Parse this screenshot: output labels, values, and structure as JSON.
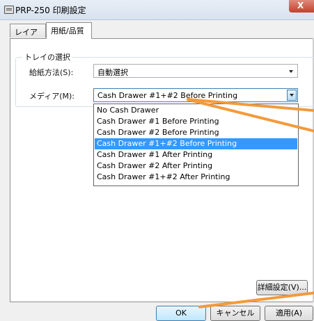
{
  "window": {
    "title": "PRP-250 印刷設定",
    "close_label": "X"
  },
  "tabs": [
    {
      "label": "レイアウト",
      "active": false
    },
    {
      "label": "用紙/品質",
      "active": true
    }
  ],
  "tray_group": {
    "legend": "トレイの選択",
    "paper_source": {
      "label": "給紙方法(S):",
      "value": "自動選択"
    },
    "media": {
      "label": "メディア(M):",
      "value": "Cash Drawer #1+#2 Before Printing",
      "options": [
        "No Cash Drawer",
        "Cash Drawer #1 Before Printing",
        "Cash Drawer #2 Before Printing",
        "Cash Drawer #1+#2 Before Printing",
        "Cash Drawer #1 After Printing",
        "Cash Drawer #2 After Printing",
        "Cash Drawer #1+#2 After Printing"
      ],
      "selected_index": 3
    }
  },
  "buttons": {
    "advanced": "詳細設定(V)...",
    "ok": "OK",
    "cancel": "キャンセル",
    "apply": "適用(A)"
  },
  "colors": {
    "selection": "#3399ff",
    "annotation": "#f39a3c"
  }
}
